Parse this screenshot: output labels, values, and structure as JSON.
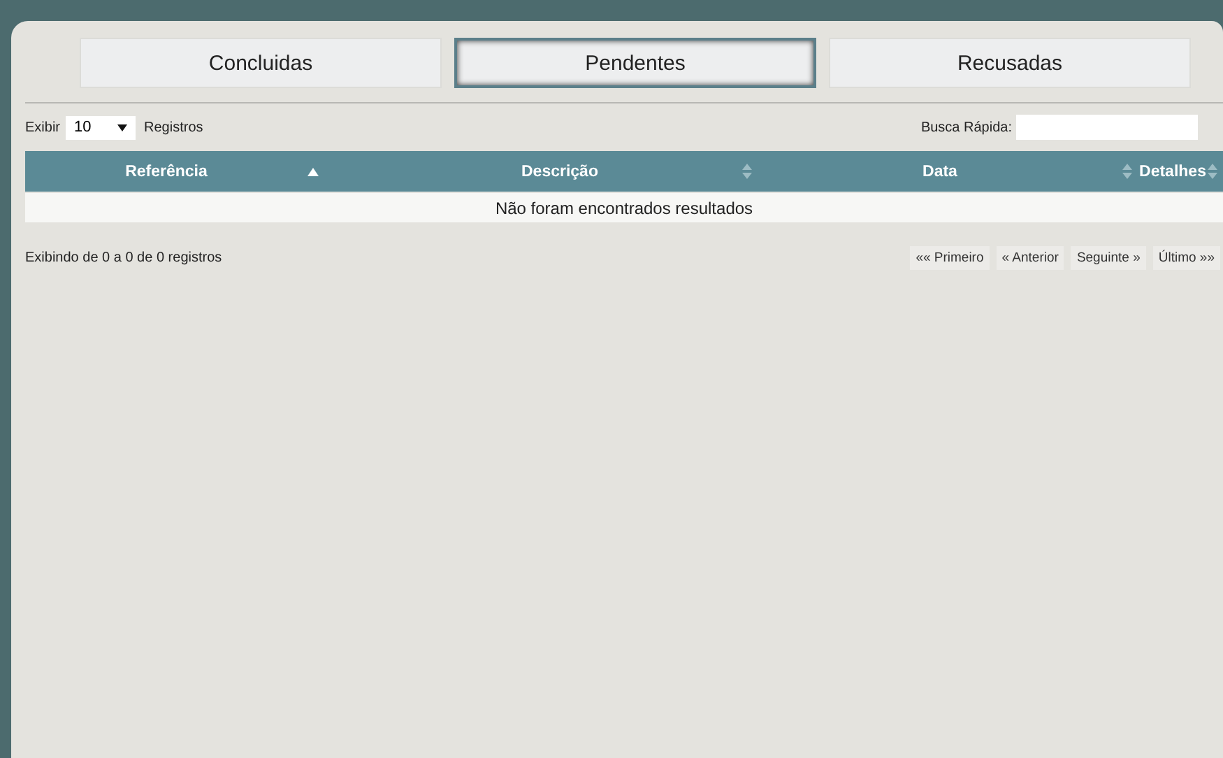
{
  "tabs": [
    {
      "label": "Concluidas",
      "selected": false
    },
    {
      "label": "Pendentes",
      "selected": true
    },
    {
      "label": "Recusadas",
      "selected": false
    }
  ],
  "length": {
    "prefix": "Exibir",
    "value": "10",
    "suffix": "Registros"
  },
  "search": {
    "label": "Busca Rápida:"
  },
  "table": {
    "columns": [
      {
        "label": "Referência",
        "sorted_ascending": true
      },
      {
        "label": "Descrição",
        "sorted_ascending": false
      },
      {
        "label": "Data",
        "sorted_ascending": false
      },
      {
        "label": "Detalhes",
        "sorted_ascending": false
      }
    ],
    "empty_message": "Não foram encontrados resultados"
  },
  "info": "Exibindo de 0 a 0 de 0 registros",
  "pagination": [
    "«« Primeiro",
    "« Anterior",
    "Seguinte »",
    "Último »»"
  ]
}
